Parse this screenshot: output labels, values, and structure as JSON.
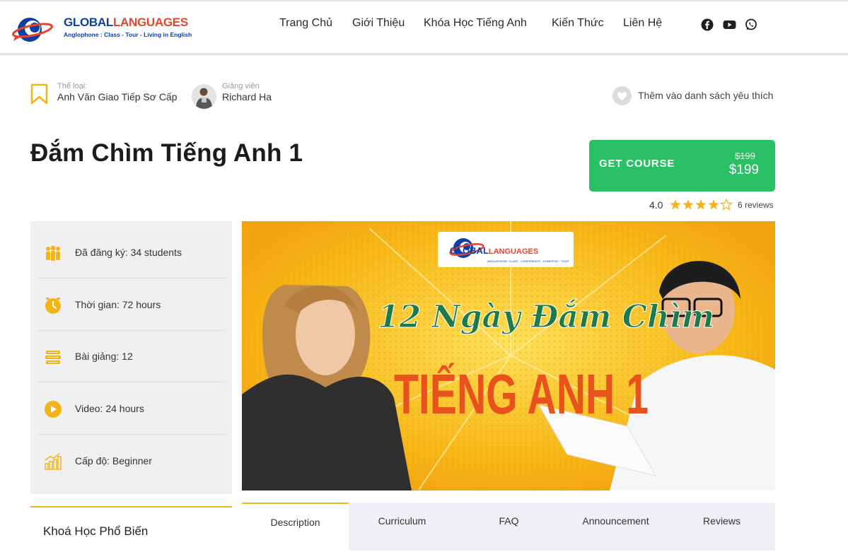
{
  "header": {
    "logo_text_part1": "GLOBAL",
    "logo_text_part2": "LANGUAGES",
    "logo_tagline": "Anglophone : Class - Tour - Living in English",
    "nav": [
      "Trang Chủ",
      "Giới Thiệu",
      "Khóa Học Tiếng Anh",
      "Kiến Thức",
      "Liên Hệ"
    ],
    "social_icons": [
      "facebook-icon",
      "youtube-icon",
      "whatsapp-icon"
    ]
  },
  "course_meta": {
    "category_label": "Thể loại:",
    "category_value": "Anh Văn Giao Tiếp Sơ Cấp",
    "instructor_label": "Giảng viên",
    "instructor_name": "Richard Ha",
    "wishlist_text": "Thêm vào danh sách yêu thích"
  },
  "title": "Đắm Chìm Tiếng Anh 1",
  "purchase": {
    "button_label": "GET COURSE",
    "old_price": "$199",
    "price": "$199"
  },
  "rating": {
    "score": "4.0",
    "stars": 4,
    "max_stars": 5,
    "reviews_text": "6 reviews"
  },
  "sidebar": {
    "items": [
      {
        "icon": "students-icon",
        "text": "Đã đăng ký: 34 students"
      },
      {
        "icon": "clock-icon",
        "text": "Thời gian: 72 hours"
      },
      {
        "icon": "books-icon",
        "text": "Bài giảng: 12"
      },
      {
        "icon": "play-icon",
        "text": "Video: 24 hours"
      },
      {
        "icon": "level-chart-icon",
        "text": "Cấp độ: Beginner"
      }
    ]
  },
  "popular": {
    "title": "Khoá Học Phổ Biến"
  },
  "banner": {
    "logo_text_part1": "GLOBAL",
    "logo_text_part2": "LANGUAGES",
    "logo_tagline": "ANGLOPHONE: CLASS - CONFERENCE - HOMESTAY - TOUR",
    "script_title": "12 Ngày Đắm Chìm",
    "main_title": "TIẾNG ANH 1"
  },
  "tabs": [
    "Description",
    "Curriculum",
    "FAQ",
    "Announcement",
    "Reviews"
  ],
  "colors": {
    "accent_yellow": "#f2b417",
    "green_button": "#2ac164",
    "sidebar_bg": "#f0f0f3",
    "banner_yellow": "#f6b51a"
  }
}
